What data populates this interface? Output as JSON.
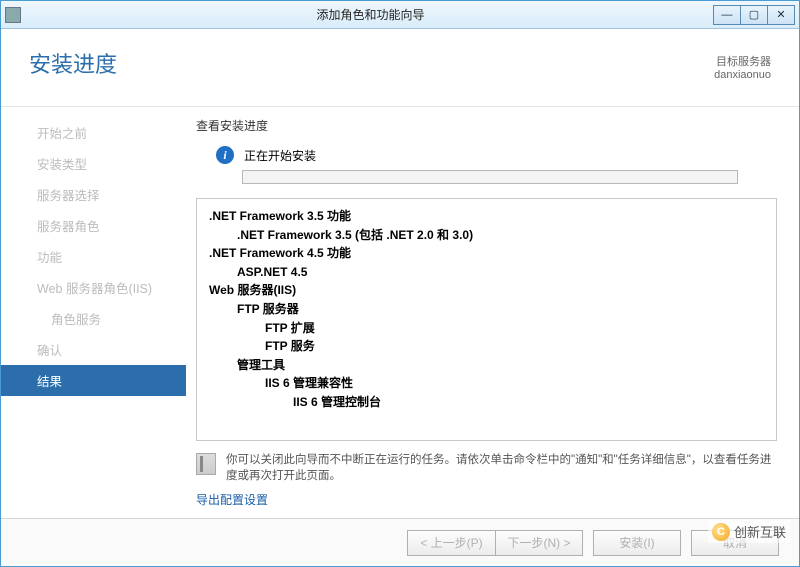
{
  "window": {
    "title": "添加角色和功能向导"
  },
  "header": {
    "page_title": "安装进度",
    "server_label": "目标服务器",
    "server_name": "danxiaonuo"
  },
  "sidebar": {
    "steps": [
      {
        "label": "开始之前"
      },
      {
        "label": "安装类型"
      },
      {
        "label": "服务器选择"
      },
      {
        "label": "服务器角色"
      },
      {
        "label": "功能"
      },
      {
        "label": "Web 服务器角色(IIS)"
      },
      {
        "label": "角色服务"
      },
      {
        "label": "确认"
      },
      {
        "label": "结果"
      }
    ]
  },
  "main": {
    "section_label": "查看安装进度",
    "status_text": "正在开始安装",
    "features": [
      {
        "cls": "l0",
        "text": ".NET Framework 3.5 功能"
      },
      {
        "cls": "l1b",
        "text": ".NET Framework 3.5 (包括 .NET 2.0 和 3.0)"
      },
      {
        "cls": "l0",
        "text": ".NET Framework 4.5 功能"
      },
      {
        "cls": "l1b",
        "text": "ASP.NET 4.5"
      },
      {
        "cls": "l0",
        "text": "Web 服务器(IIS)"
      },
      {
        "cls": "l1b",
        "text": "FTP 服务器"
      },
      {
        "cls": "l2b",
        "text": "FTP 扩展"
      },
      {
        "cls": "l2b",
        "text": "FTP 服务"
      },
      {
        "cls": "l1b",
        "text": "管理工具"
      },
      {
        "cls": "l2b",
        "text": "IIS 6 管理兼容性"
      },
      {
        "cls": "l3b",
        "text": "IIS 6 管理控制台"
      }
    ],
    "note_text": "你可以关闭此向导而不中断正在运行的任务。请依次单击命令栏中的\"通知\"和\"任务详细信息\"，以查看任务进度或再次打开此页面。",
    "export_link": "导出配置设置"
  },
  "footer": {
    "prev": "< 上一步(P)",
    "next": "下一步(N) >",
    "install": "安装(I)",
    "cancel": "取消"
  },
  "watermark": "创新互联"
}
